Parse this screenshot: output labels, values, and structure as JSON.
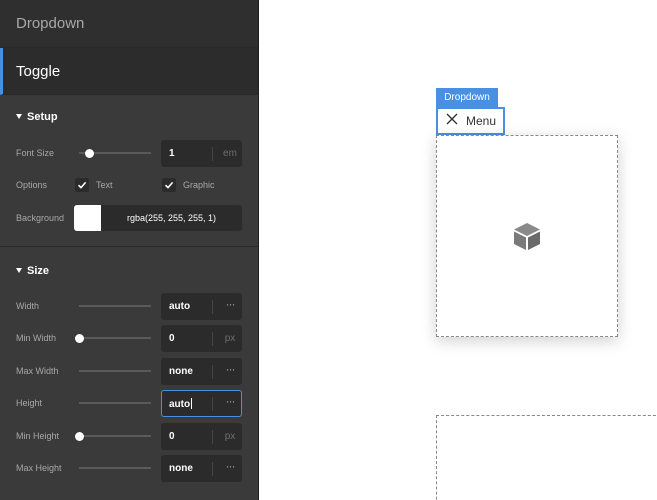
{
  "nav": {
    "dropdown_label": "Dropdown",
    "toggle_label": "Toggle"
  },
  "setup": {
    "title": "Setup",
    "font_size": {
      "label": "Font Size",
      "value": "1",
      "unit": "em",
      "slider_level": 0.15
    },
    "options": {
      "label": "Options",
      "text": {
        "label": "Text",
        "checked": true
      },
      "graphic": {
        "label": "Graphic",
        "checked": true
      }
    },
    "background": {
      "label": "Background",
      "value": "rgba(255, 255, 255, 1)",
      "color": "#ffffff"
    }
  },
  "size": {
    "title": "Size",
    "width": {
      "label": "Width",
      "value": "auto",
      "more": "···"
    },
    "min_width": {
      "label": "Min Width",
      "value": "0",
      "unit": "px",
      "slider_level": 0.0
    },
    "max_width": {
      "label": "Max Width",
      "value": "none",
      "more": "···"
    },
    "height": {
      "label": "Height",
      "value": "auto",
      "more": "···"
    },
    "min_height": {
      "label": "Min Height",
      "value": "0",
      "unit": "px",
      "slider_level": 0.0
    },
    "max_height": {
      "label": "Max Height",
      "value": "none",
      "more": "···"
    }
  },
  "canvas": {
    "badge_label": "Dropdown",
    "toggle_text": "Menu",
    "box_icon": "cube-icon",
    "close_icon": "close-icon"
  },
  "colors": {
    "accent": "#4a90e2",
    "panel_bg": "#3a3a3a"
  }
}
